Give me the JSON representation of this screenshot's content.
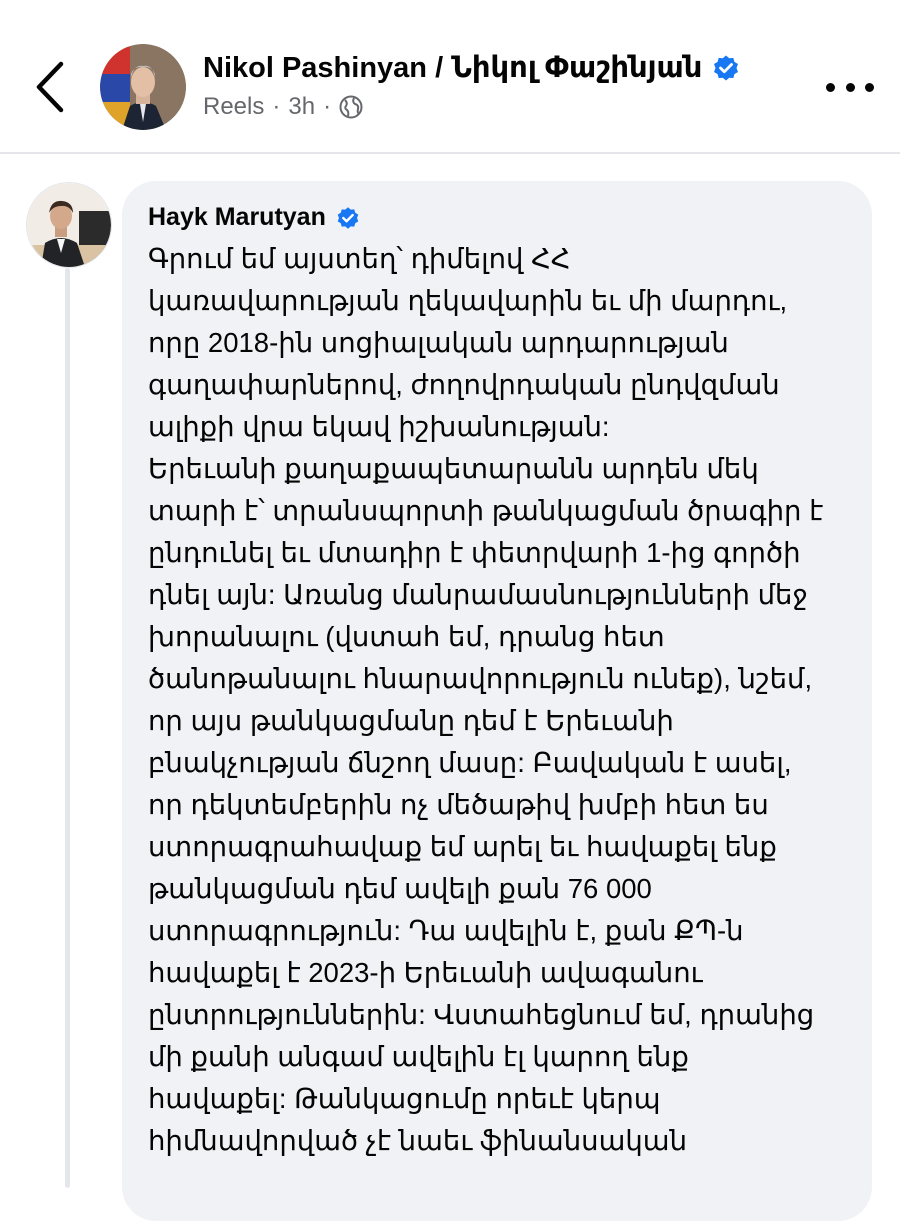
{
  "post": {
    "author_name": "Nikol Pashinyan / Նիկոլ Փաշինյան",
    "source": "Reels",
    "separator": "·",
    "time": "3h",
    "icons": {
      "back": "chevron-left-icon",
      "verified": "verified-badge-icon",
      "audience": "globe-icon",
      "more": "more-icon"
    }
  },
  "comment": {
    "author_name": "Hayk Marutyan",
    "lines": [
      "Գրում եմ այստեղ՝ դիմելով ՀՀ",
      "կառավարության ղեկավարին եւ մի մարդու,",
      "որը 2018-ին սոցիալական արդարության",
      "գաղափարներով, ժողովրդական ընդվզման",
      "ալիքի վրա եկավ իշխանության:",
      "Երեւանի քաղաքապետարանն արդեն մեկ",
      "տարի է՝ տրանսպորտի թանկացման ծրագիր է",
      "ընդունել եւ մտադիր է փետրվարի 1-ից գործի",
      "դնել այն: Առանց մանրամասնությունների մեջ",
      "խորանալու (վստահ եմ, դրանց հետ",
      "ծանոթանալու հնարավորություն ունեք), նշեմ,",
      "որ այս թանկացմանը դեմ է Երեւանի",
      "բնակչության ճնշող մասը: Բավական է ասել,",
      "որ դեկտեմբերին ոչ մեծաթիվ խմբի հետ  ես",
      "ստորագրահավաք եմ արել եւ հավաքել ենք",
      "թանկացման դեմ ավելի քան 76 000",
      "ստորագրություն: Դա ավելին է, քան ՔՊ-ն",
      "հավաքել է 2023-ի Երեւանի ավագանու",
      "ընտրություններին: Վստահեցնում եմ, դրանից",
      "մի քանի անգամ ավելին էլ կարող ենք",
      "հավաքել: Թանկացումը որեւէ կերպ",
      "հիմնավորված չէ նաեւ ֆինանսական"
    ]
  },
  "colors": {
    "accent_blue": "#1877f2",
    "bubble_bg": "#f0f2f5",
    "secondary_text": "#65676b"
  }
}
